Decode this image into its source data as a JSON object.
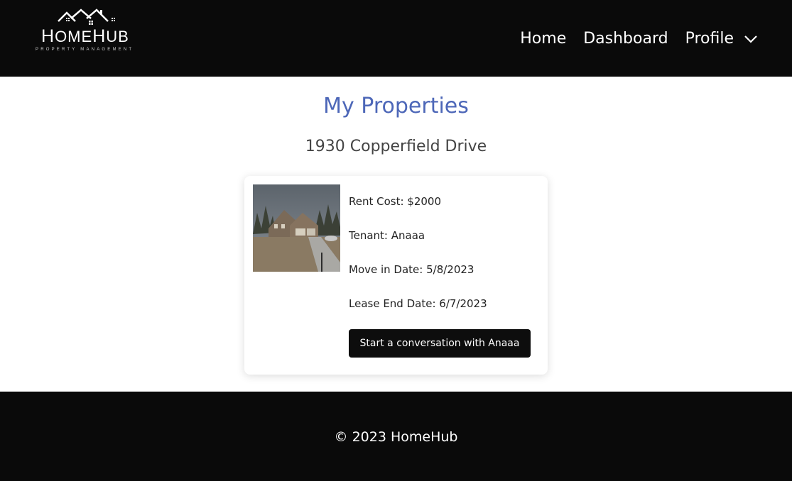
{
  "brand": {
    "name_first_letter": "H",
    "name_part1_rest": "OME",
    "name_second_letter": "H",
    "name_part2_rest": "UB",
    "tagline": "PROPERTY MANAGEMENT"
  },
  "nav": {
    "items": [
      {
        "label": "Home"
      },
      {
        "label": "Dashboard"
      }
    ],
    "profile_label": "Profile",
    "profile_icon": "chevron-down-icon"
  },
  "main": {
    "title": "My Properties",
    "property": {
      "address": "1930 Copperfield Drive",
      "rent": "Rent Cost: $2000",
      "tenant": "Tenant: Anaaa",
      "move_in": "Move in Date: 5/8/2023",
      "lease_end": "Lease End Date: 6/7/2023",
      "chat_button": "Start a conversation with Anaaa"
    }
  },
  "footer": {
    "copyright": "© 2023 HomeHub"
  },
  "colors": {
    "nav_bg": "#0a0a0a",
    "title": "#4d67b8",
    "button_bg": "#0d0d0d"
  }
}
